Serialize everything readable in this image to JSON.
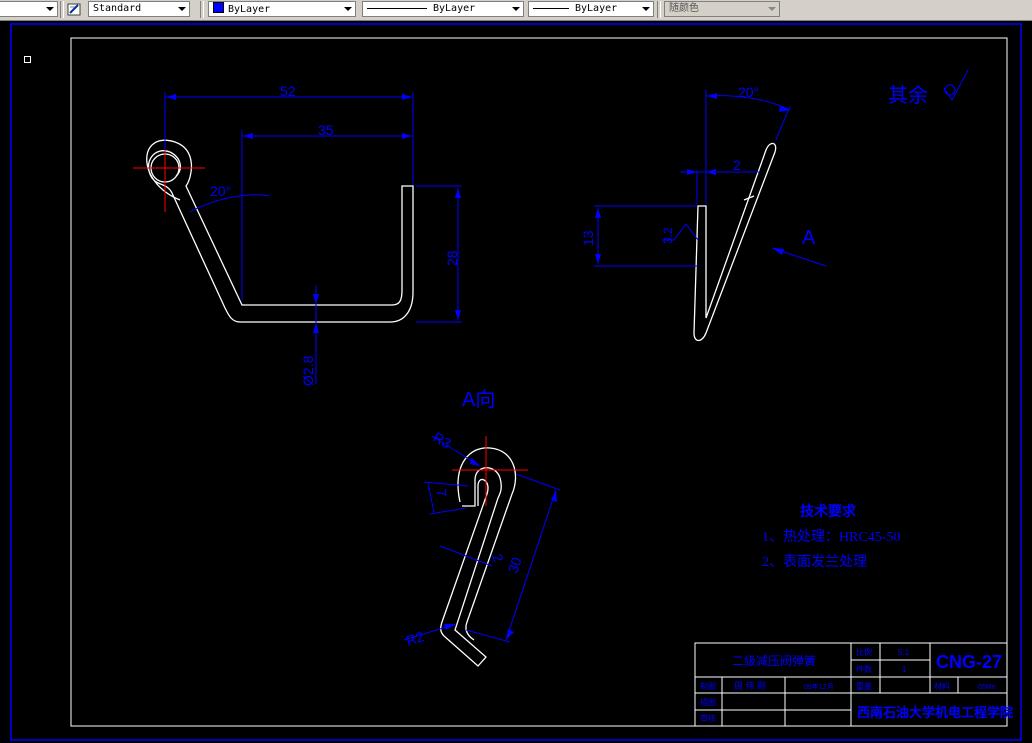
{
  "toolbar": {
    "text_style": "Standard",
    "color": "ByLayer",
    "linetype": "ByLayer",
    "lineweight": "ByLayer",
    "plot_style": "随颜色",
    "colors": {
      "bylayer_swatch": "#0000ff"
    }
  },
  "drawing": {
    "background": "#000000",
    "dims_front": {
      "d52": "52",
      "d35": "35",
      "d28": "28",
      "angle": "20°",
      "diameter": "Ø2.8"
    },
    "dims_side": {
      "angle": "20°",
      "d2": "2",
      "d13": "13",
      "rough": "3.2",
      "view_arrow": "A"
    },
    "roughness_note": "其余",
    "view_a": {
      "title": "A向",
      "r3": "R3",
      "d7": "7",
      "d2": "2",
      "d30": "30",
      "r2": "R2"
    },
    "tech_req": {
      "title": "技术要求",
      "item1": "1、热处理：HRC45-50",
      "item2": "2、表面发兰处理"
    },
    "title_block": {
      "part_name": "二级减压阀弹簧",
      "scale_label": "比例",
      "scale": "5:1",
      "qty_label": "件数",
      "qty": "1",
      "drawing_no": "CNG-27",
      "row_label_1": "制图",
      "row_label_2": "描图",
      "row_label_3": "审核",
      "drafter": "周 伟 刚",
      "date": "09年12月",
      "weight_label": "重量",
      "material_label": "材料",
      "material": "65Mn",
      "school": "西南石油大学机电工程学院"
    }
  }
}
